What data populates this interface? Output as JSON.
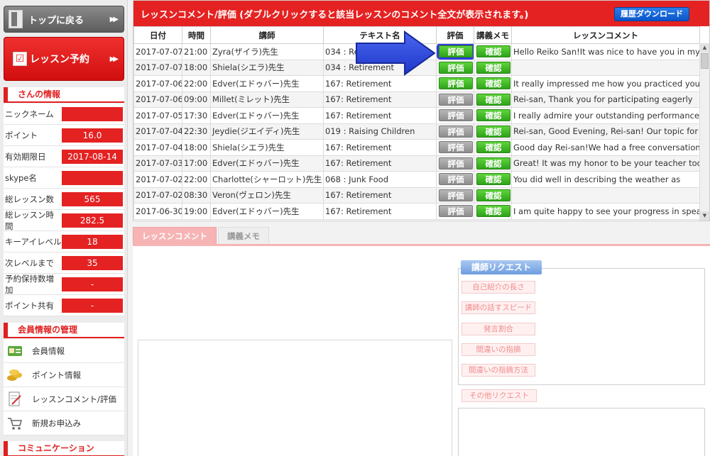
{
  "sidebar": {
    "back_label": "トップに戻る",
    "lesson_label": "レッスン予約",
    "info_header": "さんの情報",
    "info": [
      {
        "label": "ニックネーム",
        "value": ""
      },
      {
        "label": "ポイント",
        "value": "16.0"
      },
      {
        "label": "有効期限日",
        "value": "2017-08-14"
      },
      {
        "label": "skype名",
        "value": ""
      },
      {
        "label": "総レッスン数",
        "value": "565"
      },
      {
        "label": "総レッスン時間",
        "value": "282.5"
      },
      {
        "label": "キーアイレベル",
        "value": "18"
      },
      {
        "label": "次レベルまで",
        "value": "35"
      },
      {
        "label": "予約保持数増加",
        "value": "-"
      },
      {
        "label": "ポイント共有",
        "value": "-"
      }
    ],
    "member_header": "会員情報の管理",
    "menu": [
      {
        "label": "会員情報",
        "icon": "member-card-icon"
      },
      {
        "label": "ポイント情報",
        "icon": "coins-icon"
      },
      {
        "label": "レッスンコメント/評価",
        "icon": "comment-edit-icon"
      },
      {
        "label": "新規お申込み",
        "icon": "cart-icon"
      }
    ],
    "comm_header": "コミュニケーション"
  },
  "header": {
    "title": "レッスンコメント/評価 (ダブルクリックすると該当レッスンのコメント全文が表示されます。)",
    "download_label": "履歴ダウンロード"
  },
  "table": {
    "columns": [
      "日付",
      "時間",
      "講師",
      "テキスト名",
      "評価",
      "講義メモ",
      "レッスンコメント"
    ],
    "rate_label": "評価",
    "confirm_label": "確認",
    "rows": [
      {
        "date": "2017-07-07",
        "time": "21:00",
        "teacher": "Zyra(ザイラ)先生",
        "text": "034 : Re",
        "rated": true,
        "comment": "Hello Reiko San!It was nice to have you in my"
      },
      {
        "date": "2017-07-07",
        "time": "18:00",
        "teacher": "Shiela(シエラ)先生",
        "text": "034 : Retirement",
        "rated": true,
        "comment": ""
      },
      {
        "date": "2017-07-06",
        "time": "22:00",
        "teacher": "Edver(エドゥバー)先生",
        "text": "167: Retirement",
        "rated": true,
        "comment": "It really impressed me how you practiced your"
      },
      {
        "date": "2017-07-06",
        "time": "09:00",
        "teacher": "Millet(ミレット)先生",
        "text": "167: Retirement",
        "rated": false,
        "comment": "Rei-san, Thank you for participating eagerly"
      },
      {
        "date": "2017-07-05",
        "time": "17:30",
        "teacher": "Edver(エドゥバー)先生",
        "text": "167: Retirement",
        "rated": false,
        "comment": "I really admire your outstanding performance"
      },
      {
        "date": "2017-07-04",
        "time": "22:30",
        "teacher": "Jeydie(ジエイディ)先生",
        "text": "019 : Raising Children",
        "rated": false,
        "comment": "Rei-san, Good Evening, Rei-san! Our topic for"
      },
      {
        "date": "2017-07-04",
        "time": "18:00",
        "teacher": "Shiela(シエラ)先生",
        "text": "167: Retirement",
        "rated": false,
        "comment": "Good day Rei-san!We had a free conversation t"
      },
      {
        "date": "2017-07-03",
        "time": "17:00",
        "teacher": "Edver(エドゥバー)先生",
        "text": "167: Retirement",
        "rated": false,
        "comment": "Great! It was my honor to be your teacher tod"
      },
      {
        "date": "2017-07-02",
        "time": "22:00",
        "teacher": "Charlotte(シャーロット)先生",
        "text": "068 : Junk Food",
        "rated": false,
        "comment": "You did well in describing the  weather  as"
      },
      {
        "date": "2017-07-02",
        "time": "08:30",
        "teacher": "Veron(ヴェロン)先生",
        "text": "167: Retirement",
        "rated": false,
        "comment": ""
      },
      {
        "date": "2017-06-30",
        "time": "19:00",
        "teacher": "Edver(エドゥバー)先生",
        "text": "167: Retirement",
        "rated": false,
        "comment": "I am quite happy to see your progress in spea"
      }
    ]
  },
  "bottom": {
    "tab_comment": "レッスンコメント",
    "tab_memo": "講義メモ",
    "request_title": "講師リクエスト",
    "requests": [
      "自己紹介の長さ",
      "講師の話すスピード",
      "発言割合",
      "間違いの指摘",
      "間違いの指摘方法"
    ],
    "other_request": "その他リクエスト"
  },
  "colors": {
    "accent_red": "#e52222",
    "green": "#3bb322",
    "blue": "#0b55c9",
    "highlight": "#2f3fd9"
  }
}
